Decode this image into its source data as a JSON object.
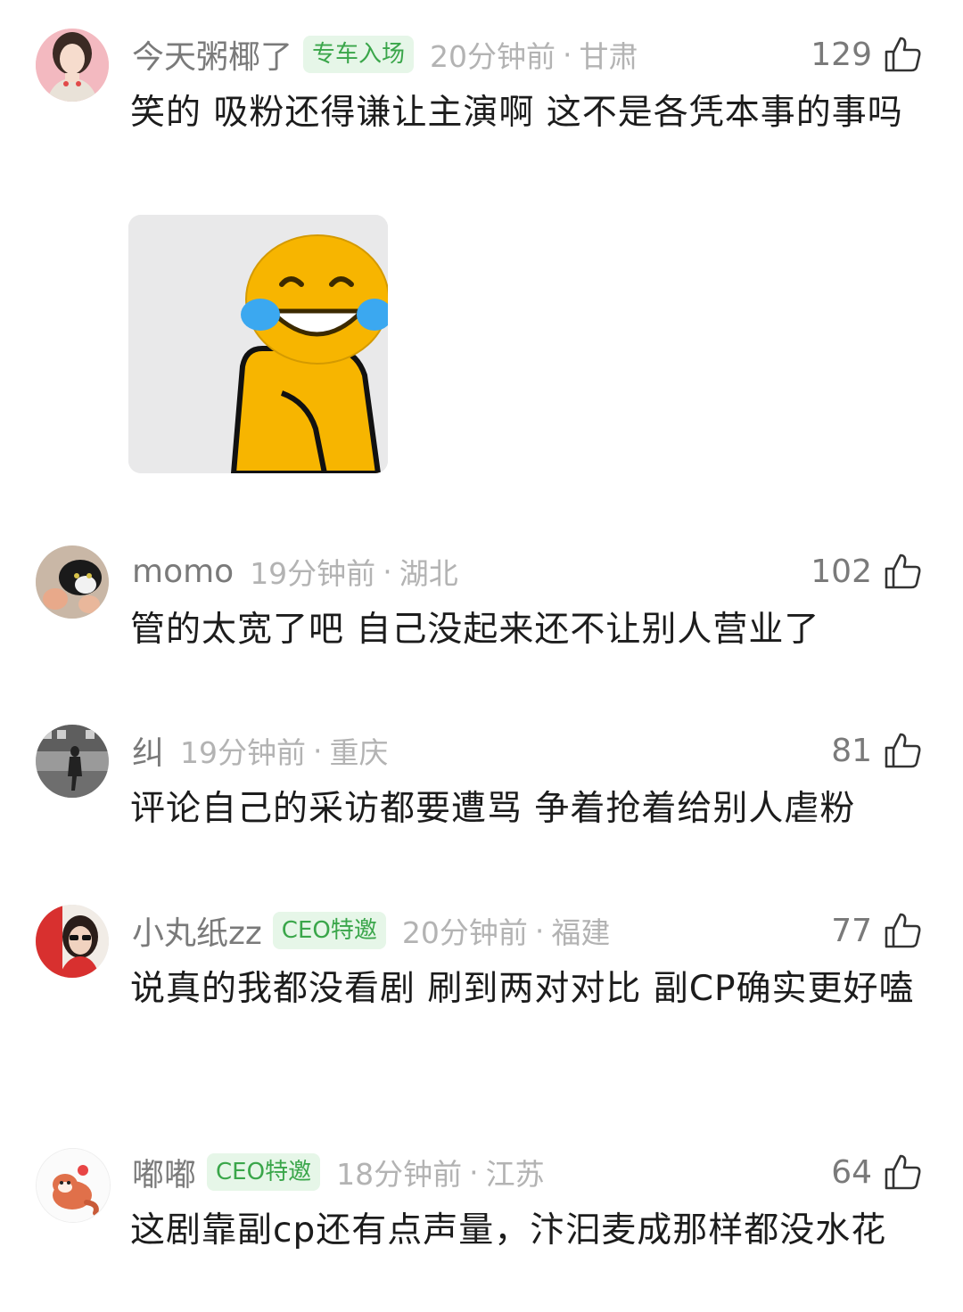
{
  "comments": [
    {
      "username": "今天粥椰了",
      "badge": "专车入场",
      "time": "20分钟前",
      "region": "甘肃",
      "likes": "129",
      "text": "笑的 吸粉还得谦让主演啊 这不是各凭本事的事吗",
      "avatar": "avatar-woman-red-background",
      "sticker": "laughing-crying-emoji-sticker"
    },
    {
      "username": "momo",
      "badge": "",
      "time": "19分钟前",
      "region": "湖北",
      "likes": "102",
      "text": "管的太宽了吧  自己没起来还不让别人营业了",
      "avatar": "avatar-cat-photo"
    },
    {
      "username": "纠",
      "badge": "",
      "time": "19分钟前",
      "region": "重庆",
      "likes": "81",
      "text": "评论自己的采访都要遭骂 争着抢着给别人虐粉",
      "avatar": "avatar-grayscale-street"
    },
    {
      "username": "小丸纸zz",
      "badge": "CEO特邀",
      "time": "20分钟前",
      "region": "福建",
      "likes": "77",
      "text": "说真的我都没看剧 刷到两对对比 副CP确实更好嗑",
      "avatar": "avatar-woman-sunglasses-red"
    },
    {
      "username": "嘟嘟",
      "badge": "CEO特邀",
      "time": "18分钟前",
      "region": "江苏",
      "likes": "64",
      "text": "这剧靠副cp还有点声量，汴汩麦成那样都没水花",
      "avatar": "avatar-red-panda-cartoon"
    }
  ],
  "colors": {
    "meta_gray": "#b3b3b3",
    "username_gray": "#7a7a7a",
    "badge_green": "#3aa64a",
    "badge_bg": "#e6f6e8",
    "text": "#1c1c1c"
  },
  "icons": {
    "like": "thumbs-up-icon"
  }
}
